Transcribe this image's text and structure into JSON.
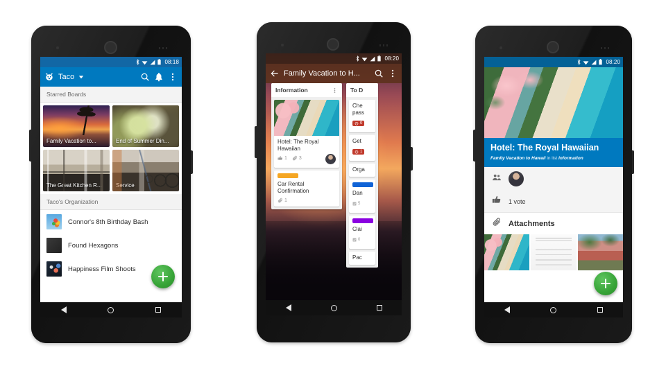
{
  "page": {
    "background": "#ffffff",
    "accent_blue": "#0079bf",
    "accent_green": "#37a337"
  },
  "phones": [
    {
      "id": "phone-boards",
      "status_bar": {
        "time": "08:18",
        "icons": [
          "bluetooth-icon",
          "wifi-icon",
          "signal-icon",
          "battery-icon"
        ],
        "background": "#1267a5"
      },
      "app_bar": {
        "background": "#0079bf",
        "avatar_icon": "husky-avatar-icon",
        "title": "Taco",
        "dropdown_icon": "caret-down-icon",
        "actions": [
          "search-icon",
          "notifications-bell-icon",
          "overflow-menu-icon"
        ]
      },
      "sections": [
        {
          "header": "Starred Boards",
          "type": "grid",
          "boards": [
            {
              "title": "Family Vacation to...",
              "thumb": "sunset-beach-photo"
            },
            {
              "title": "End of Summer Din...",
              "thumb": "flowers-bokeh-photo"
            },
            {
              "title": "The Great Kitchen R...",
              "thumb": "kitchen-interior-photo"
            },
            {
              "title": "Service",
              "thumb": "bike-shop-photo"
            }
          ]
        },
        {
          "header": "Taco's Organization",
          "type": "list",
          "boards": [
            {
              "title": "Connor's 8th Birthday Bash",
              "thumb": "balloons-photo"
            },
            {
              "title": "Found Hexagons",
              "thumb": "dark-texture-photo"
            },
            {
              "title": "Happiness Film Shoots",
              "thumb": "film-lights-photo"
            }
          ]
        }
      ],
      "fab": {
        "icon": "plus-icon",
        "color": "#37a337"
      },
      "nav_bar": [
        "back-triangle-icon",
        "home-circle-icon",
        "recents-square-icon"
      ]
    },
    {
      "id": "phone-board",
      "status_bar": {
        "time": "08:20",
        "icons": [
          "bluetooth-icon",
          "wifi-icon",
          "signal-icon",
          "battery-icon"
        ],
        "background": "#3d2318"
      },
      "app_bar": {
        "background": "rgba(90,48,26,0.82)",
        "back_icon": "back-arrow-icon",
        "title": "Family Vacation to H...",
        "actions": [
          "search-icon",
          "overflow-menu-icon"
        ]
      },
      "lists": [
        {
          "name": "Information",
          "menu_icon": "overflow-menu-icon",
          "cards": [
            {
              "title": "Hotel: The Royal Hawaiian",
              "cover": "royal-hawaiian-aerial-photo",
              "votes": "1",
              "attachments": "3",
              "avatar": "member-avatar-icon"
            },
            {
              "title": "Car Rental Confirmation",
              "label_color": "#f5a623",
              "attachments": "1"
            }
          ]
        },
        {
          "name": "To D",
          "partial": true,
          "cards": [
            {
              "title": "Che\npass",
              "due": "0"
            },
            {
              "title": "Get",
              "due": "1"
            },
            {
              "title": "Orga"
            },
            {
              "title": "Dan",
              "label_color": "#1063d6",
              "checklist": "5"
            },
            {
              "title": "Clai",
              "label_color": "#8a00e0",
              "checklist": "0"
            },
            {
              "title": "Pac"
            }
          ]
        }
      ],
      "nav_bar": [
        "back-triangle-icon",
        "home-circle-icon",
        "recents-square-icon"
      ]
    },
    {
      "id": "phone-card-detail",
      "status_bar": {
        "time": "08:20",
        "icons": [
          "bluetooth-icon",
          "wifi-icon",
          "signal-icon",
          "battery-icon"
        ],
        "background": "#005c91"
      },
      "hero": "royal-hawaiian-aerial-photo",
      "banner": {
        "background": "#0079bf",
        "title": "Hotel: The Royal Hawaiian",
        "subtitle_board": "Family Vacation to Hawaii",
        "subtitle_mid": " in list ",
        "subtitle_list": "Information"
      },
      "rows": [
        {
          "icon": "members-icon",
          "avatar": "member-avatar-icon"
        },
        {
          "icon": "thumbs-up-icon",
          "text": "1 vote"
        },
        {
          "icon": "paperclip-icon",
          "text": "Attachments",
          "emphasis": true
        }
      ],
      "attachments": [
        {
          "thumb": "royal-hawaiian-aerial-photo"
        },
        {
          "thumb": "document-scan-photo"
        },
        {
          "thumb": "pink-hotel-palms-photo"
        }
      ],
      "fab": {
        "icon": "plus-icon",
        "color": "#37a337"
      },
      "nav_bar": [
        "back-triangle-icon",
        "home-circle-icon",
        "recents-square-icon"
      ]
    }
  ]
}
